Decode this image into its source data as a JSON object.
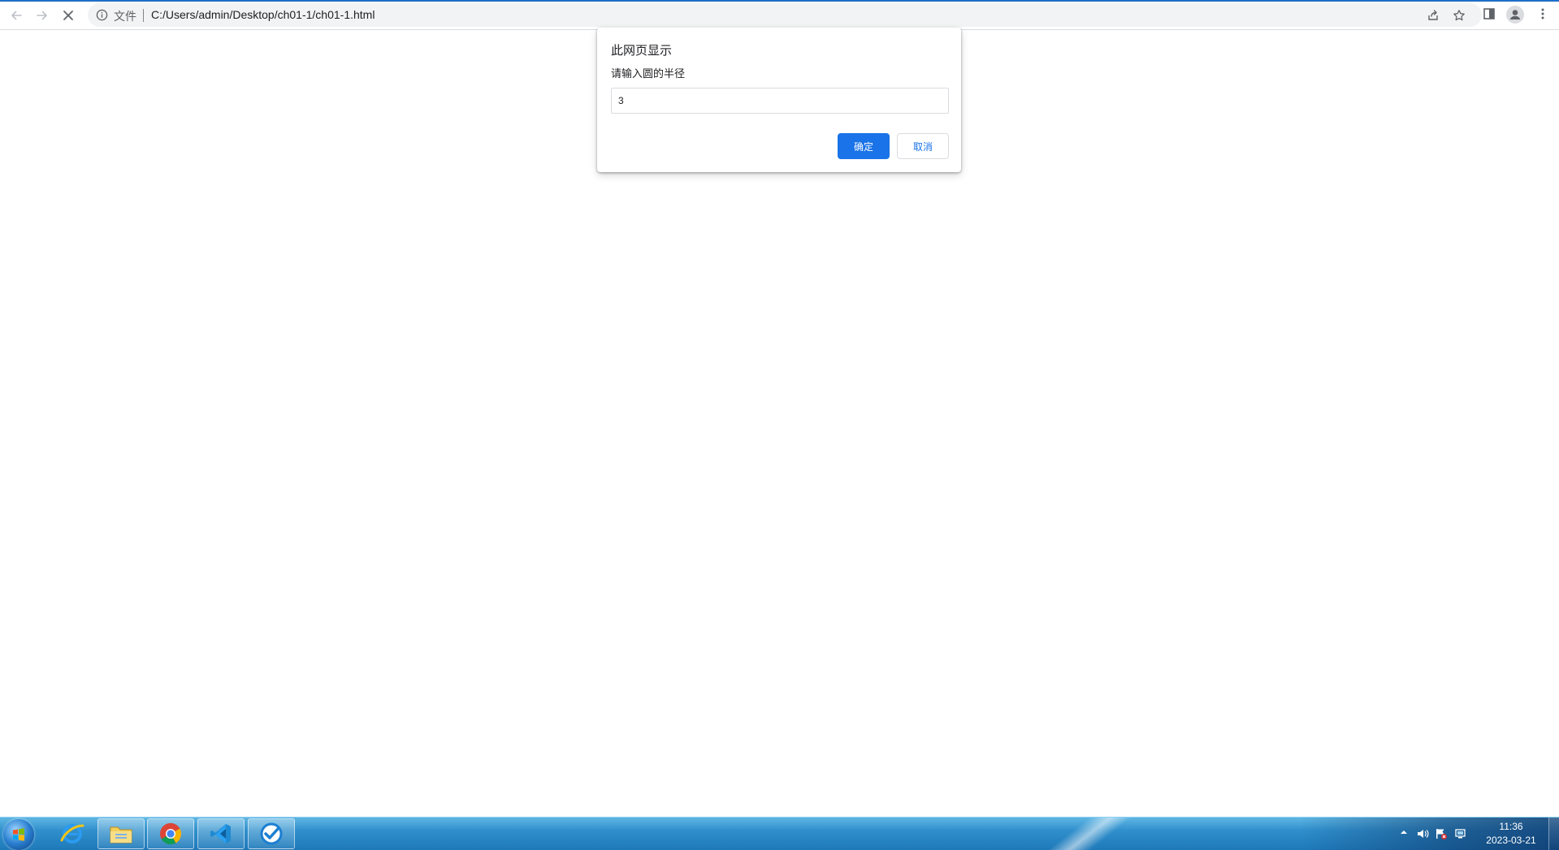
{
  "browser": {
    "scheme_label": "文件",
    "url": "C:/Users/admin/Desktop/ch01-1/ch01-1.html"
  },
  "dialog": {
    "title": "此网页显示",
    "message": "请输入圆的半径",
    "input_value": "3",
    "ok_label": "确定",
    "cancel_label": "取消"
  },
  "taskbar": {
    "apps": [
      "windows-start",
      "internet-explorer",
      "file-explorer",
      "chrome",
      "vscode",
      "check-app"
    ],
    "clock_time": "11:36",
    "clock_date": "2023-03-21"
  },
  "colors": {
    "accent": "#1a73e8",
    "taskbar": "#2f8fcc"
  }
}
